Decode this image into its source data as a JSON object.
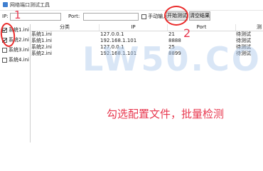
{
  "window": {
    "title": "网络端口测试工具"
  },
  "toolbar": {
    "ip_label": "IP:",
    "ip_value": "",
    "port_label": "Port:",
    "port_value": "",
    "manual_label": "手动输入",
    "start_label": "开始测试",
    "clear_label": "清空结果"
  },
  "left_panel": {
    "items": [
      {
        "label": "系统1.ini",
        "checked": true
      },
      {
        "label": "系统2.ini",
        "checked": true
      },
      {
        "label": "系统3.ini",
        "checked": false
      },
      {
        "label": "系统4.ini",
        "checked": false
      }
    ]
  },
  "table": {
    "headers": [
      "分类",
      "IP",
      "Port",
      "测"
    ],
    "rows": [
      [
        "系统1.ini",
        "127.0.0.1",
        "21",
        "待测试"
      ],
      [
        "系统1.ini",
        "192.168.1.101",
        "8888",
        "待测试"
      ],
      [
        "系统2.ini",
        "127.0.0.1",
        "25",
        "待测试"
      ],
      [
        "系统2.ini",
        "192.168.1.101",
        "8899",
        "待测试"
      ]
    ]
  },
  "annotations": {
    "number_1": "1",
    "number_2": "2",
    "caption": "勾选配置文件，批量检测",
    "color": "#e8384f"
  },
  "watermark": {
    "text": "LW50.COM"
  }
}
